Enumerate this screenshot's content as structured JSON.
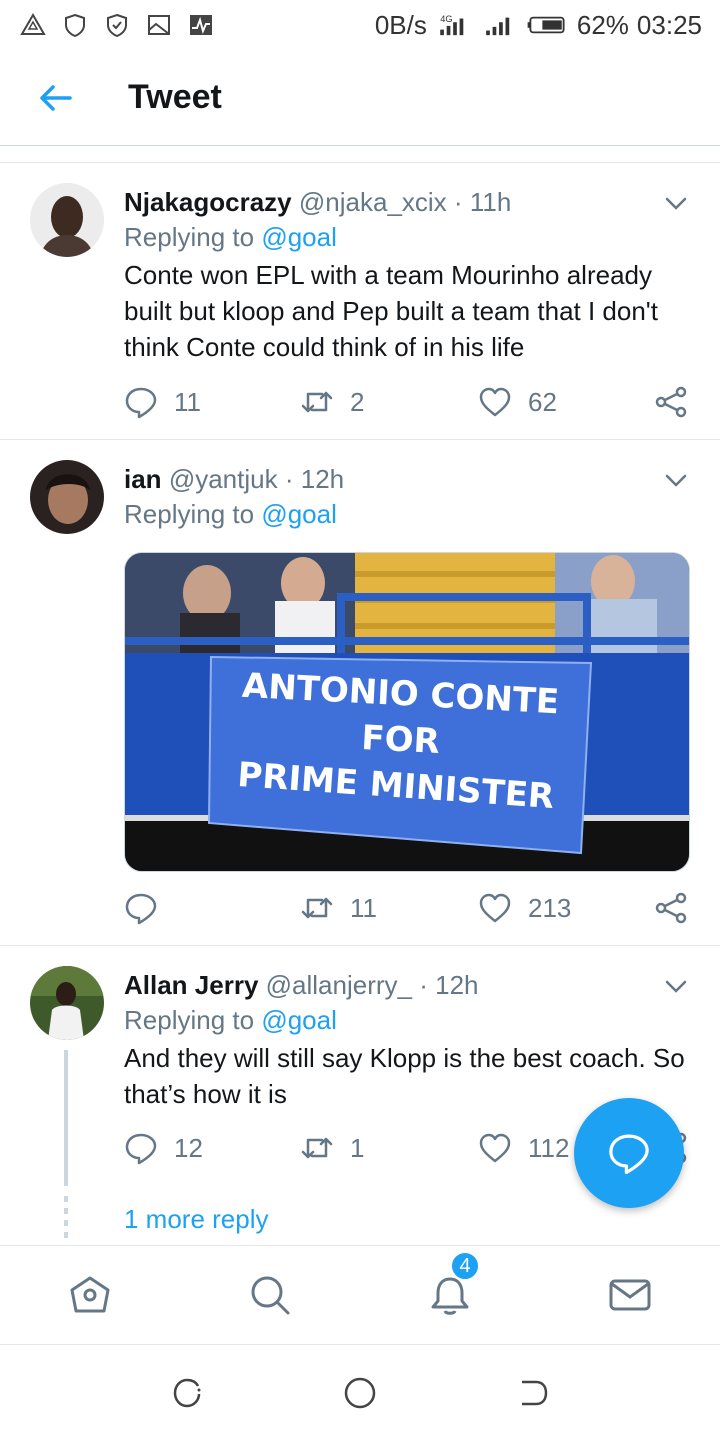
{
  "status_bar": {
    "speed": "0B/s",
    "network": "4G",
    "battery": "62%",
    "time": "03:25"
  },
  "header": {
    "title": "Tweet"
  },
  "tweets": [
    {
      "name": "Njakagocrazy",
      "handle": "@njaka_xcix",
      "dot": "·",
      "time": "11h",
      "replying_prefix": "Replying to",
      "replying_to": "@goal",
      "text": "Conte won EPL with a team Mourinho already built but kloop and Pep built a team that I don't think Conte could think of in his life",
      "replies": "11",
      "retweets": "2",
      "likes": "62"
    },
    {
      "name": "ian",
      "handle": "@yantjuk",
      "dot": "·",
      "time": "12h",
      "replying_prefix": "Replying to",
      "replying_to": "@goal",
      "image_banner": [
        "ANTONIO CONTE",
        "FOR",
        "PRIME MINISTER"
      ],
      "replies": "",
      "retweets": "11",
      "likes": "213"
    },
    {
      "name": "Allan Jerry",
      "handle": "@allanjerry_",
      "dot": "·",
      "time": "12h",
      "replying_prefix": "Replying to",
      "replying_to": "@goal",
      "text": "And they will still say Klopp is the best coach. So that’s how it is",
      "replies": "12",
      "retweets": "1",
      "likes": "112"
    }
  ],
  "more_reply": "1 more reply",
  "nav": {
    "notification_count": "4"
  },
  "colors": {
    "accent": "#1da1f2",
    "text": "#14171a",
    "muted": "#657786"
  }
}
